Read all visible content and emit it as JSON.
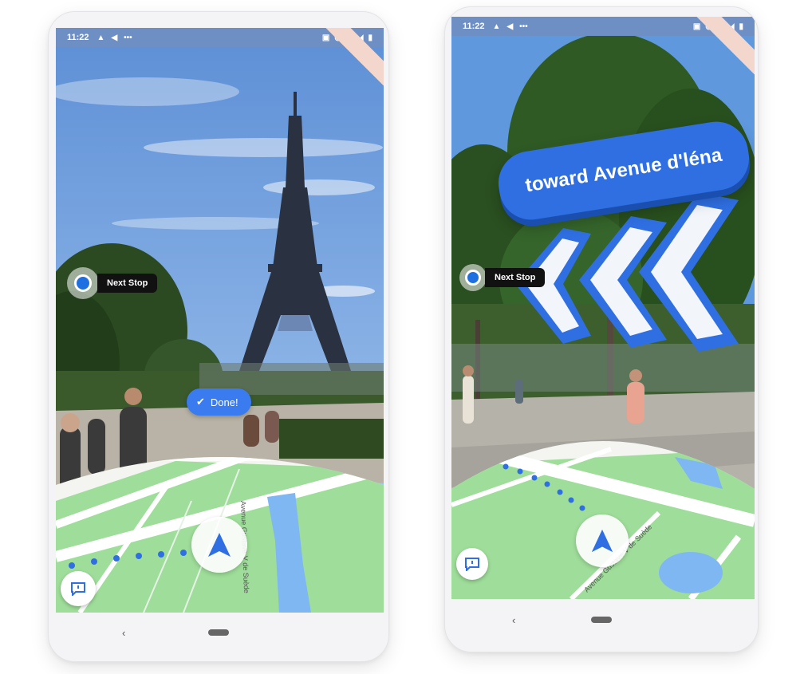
{
  "status_bar": {
    "time": "11:22",
    "left_icons": [
      "navigation-icon",
      "location-icon",
      "more-icon"
    ],
    "right_icons": [
      "cast-icon",
      "location-icon",
      "wifi-icon",
      "signal-icon",
      "battery-icon"
    ]
  },
  "left_screen": {
    "next_stop_label": "Next Stop",
    "done_label": "Done!",
    "map_street_label": "Avenue Gustave V de Suède"
  },
  "right_screen": {
    "next_stop_label": "Next Stop",
    "banner_text": "toward Avenue d'léna",
    "map_street_label": "Avenue Gustave V de Suède"
  },
  "colors": {
    "accent": "#2f6fe2",
    "map_green": "#9fdd9a",
    "water": "#7fb7f2",
    "route_dots": "#2f6fe2"
  }
}
